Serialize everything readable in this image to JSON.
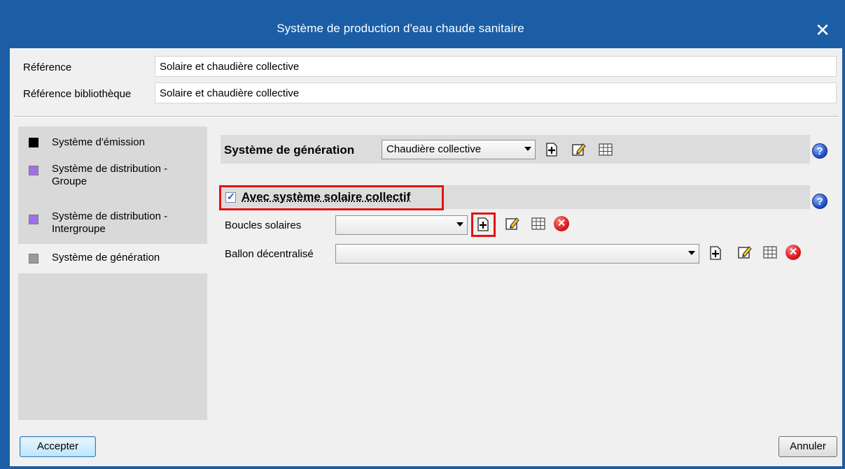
{
  "window": {
    "title": "Système de production d'eau chaude sanitaire",
    "close_icon": "close-icon"
  },
  "fields": {
    "reference_label": "Référence",
    "reference_value": "Solaire et chaudière collective",
    "library_reference_label": "Référence bibliothèque",
    "library_reference_value": "Solaire et chaudière collective"
  },
  "sidebar": {
    "items": [
      {
        "label": "Système d'émission",
        "color": "#000000",
        "selected": false
      },
      {
        "label": "Système de distribution -\nGroupe",
        "color": "#a070e8",
        "selected": false
      },
      {
        "label": "Système de distribution -\nIntergroupe",
        "color": "#a070e8",
        "selected": false
      },
      {
        "label": "Système de génération",
        "color": "#9a9a9a",
        "selected": true
      }
    ]
  },
  "generation": {
    "label": "Système de génération",
    "selected_value": "Chaudière collective",
    "icons": [
      "add-icon",
      "edit-icon",
      "table-icon"
    ],
    "help_icon": "help-icon"
  },
  "solar": {
    "checkbox_label": "Avec système solaire collectif",
    "checked": true,
    "help_icon": "help-icon",
    "solar_loops_label": "Boucles solaires",
    "solar_loops_value": "",
    "decentralized_tank_label": "Ballon décentralisé",
    "decentralized_tank_value": "",
    "row_icons": [
      "add-icon",
      "edit-icon",
      "table-icon",
      "delete-icon"
    ]
  },
  "highlight_color": "#e31313",
  "footer": {
    "accept_label": "Accepter",
    "cancel_label": "Annuler"
  }
}
